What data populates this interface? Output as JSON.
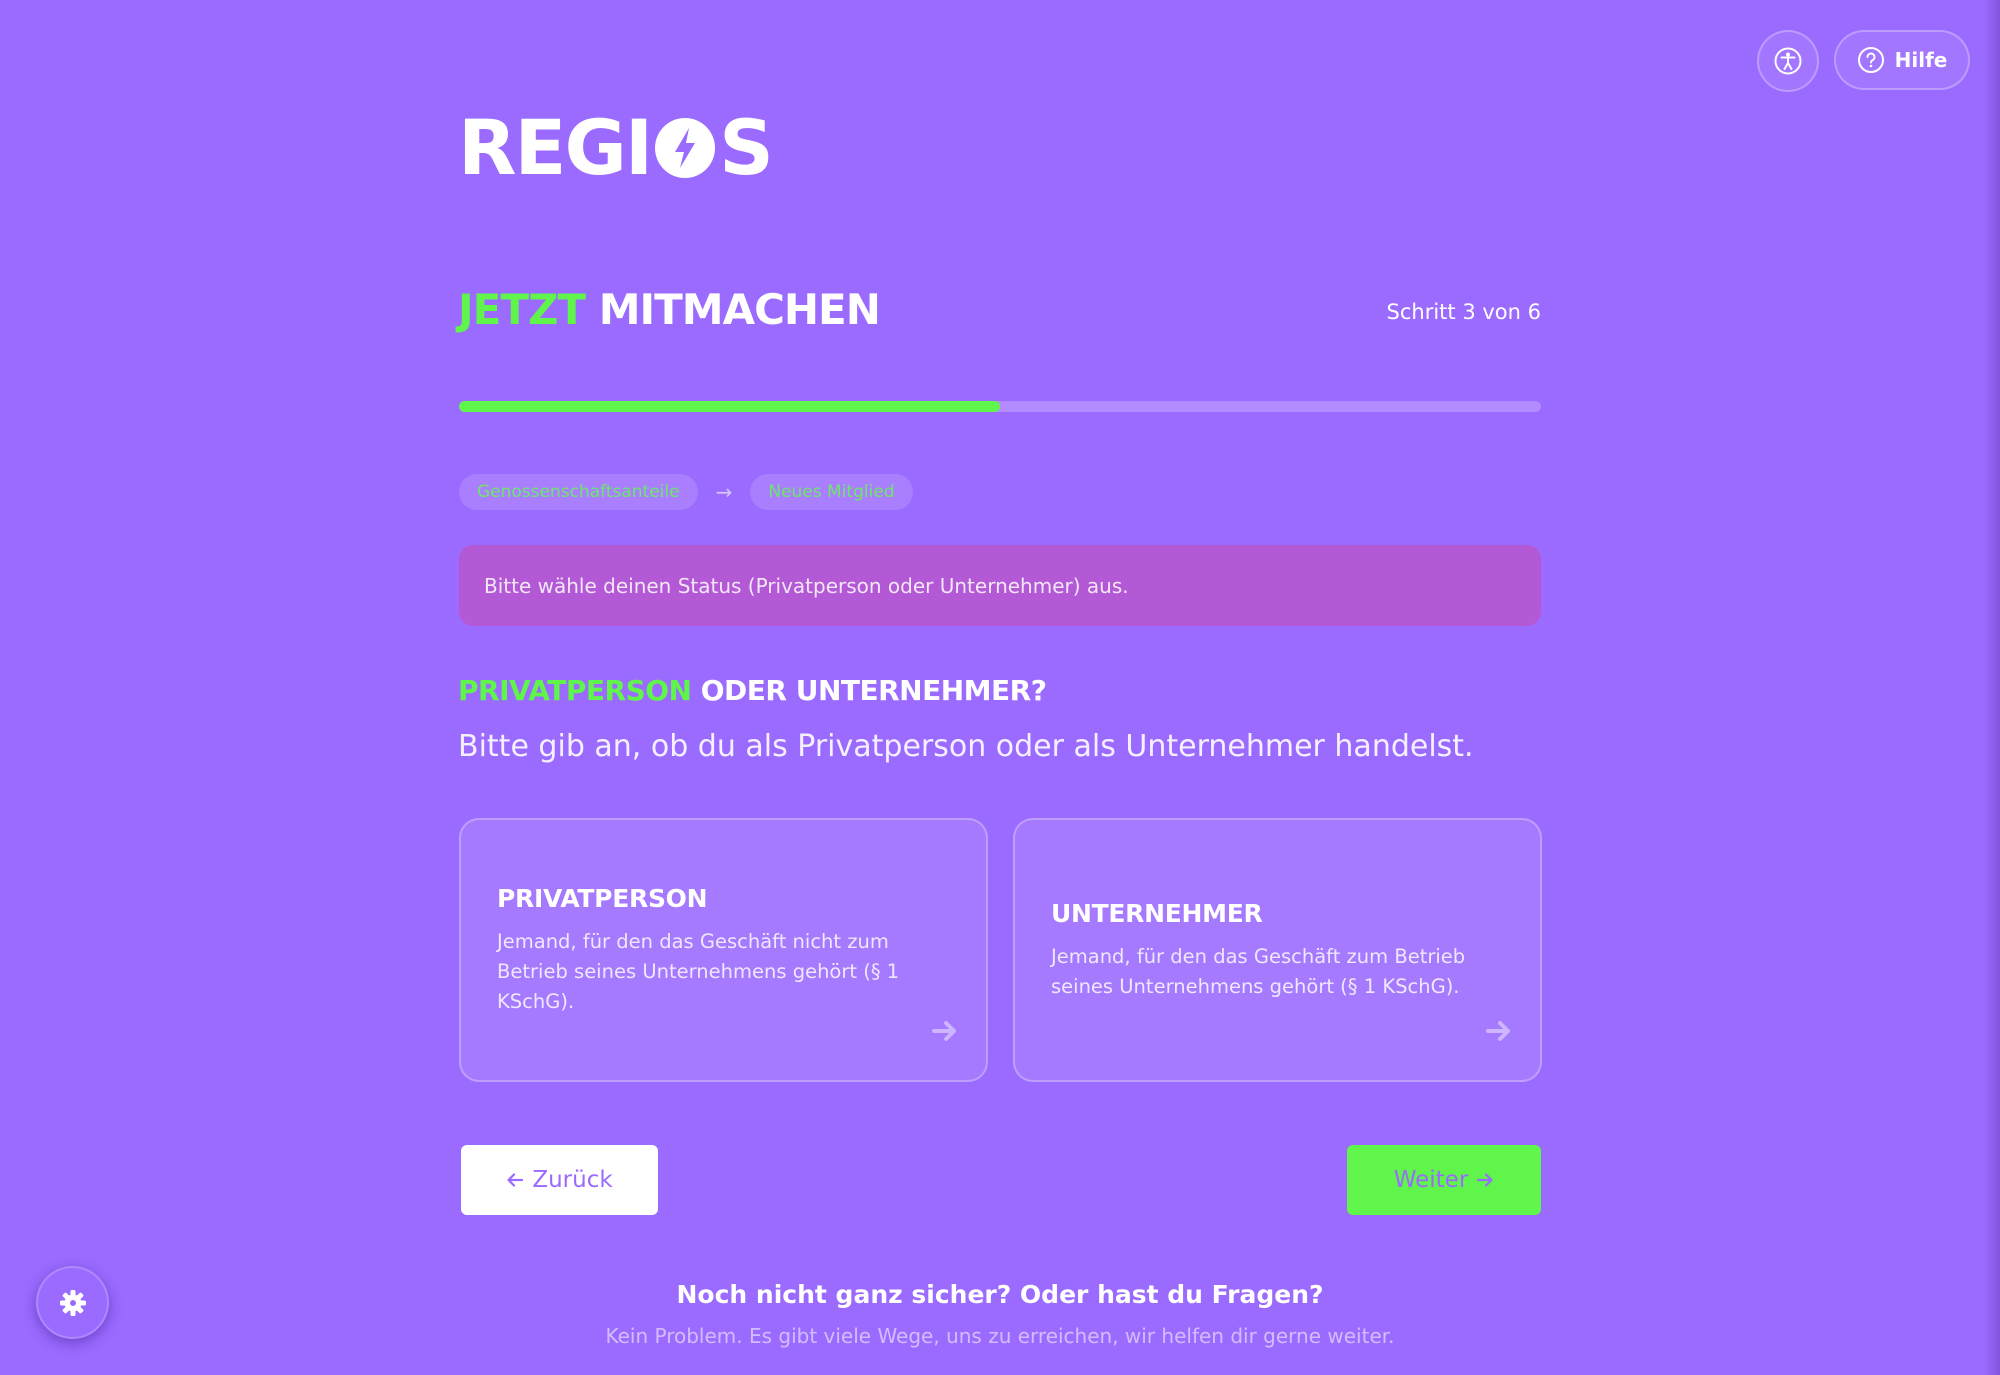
{
  "header": {
    "logo_text_left": "REGI",
    "logo_text_right": "S",
    "help_label": "Hilfe",
    "accessibility_icon": "accessibility-icon",
    "help_icon": "question-circle-icon"
  },
  "hero": {
    "title_accent": "JETZT",
    "title_rest": "MITMACHEN",
    "step_text": "Schritt 3 von 6"
  },
  "progress": {
    "value": 0.5
  },
  "breadcrumb": {
    "items": [
      "Genossenschaftsanteile",
      "Neues Mitglied"
    ],
    "separator": "→"
  },
  "alert": {
    "text": "Bitte wähle deinen Status (Privatperson oder Unternehmer) aus."
  },
  "question": {
    "title_accent": "PRIVATPERSON",
    "title_rest": "ODER UNTERNEHMER?",
    "subtitle": "Bitte gib an, ob du als Privatperson oder als Unternehmer handelst."
  },
  "options": [
    {
      "title": "PRIVATPERSON",
      "description": "Jemand, für den das Geschäft nicht zum Betrieb seines Unternehmens gehört (§ 1 KSchG)."
    },
    {
      "title": "UNTERNEHMER",
      "description": "Jemand, für den das Geschäft zum Betrieb seines Unternehmens gehört (§ 1 KSchG)."
    }
  ],
  "nav": {
    "back_label": "Zurück",
    "next_label": "Weiter"
  },
  "footer": {
    "title": "Noch nicht ganz sicher? Oder hast du Fragen?",
    "subtitle": "Kein Problem. Es gibt viele Wege, uns zu erreichen, wir helfen dir gerne weiter."
  },
  "colors": {
    "background": "#9b6bff",
    "accent_green": "#5ff54a",
    "alert_bg": "#b359d6",
    "white": "#ffffff"
  }
}
